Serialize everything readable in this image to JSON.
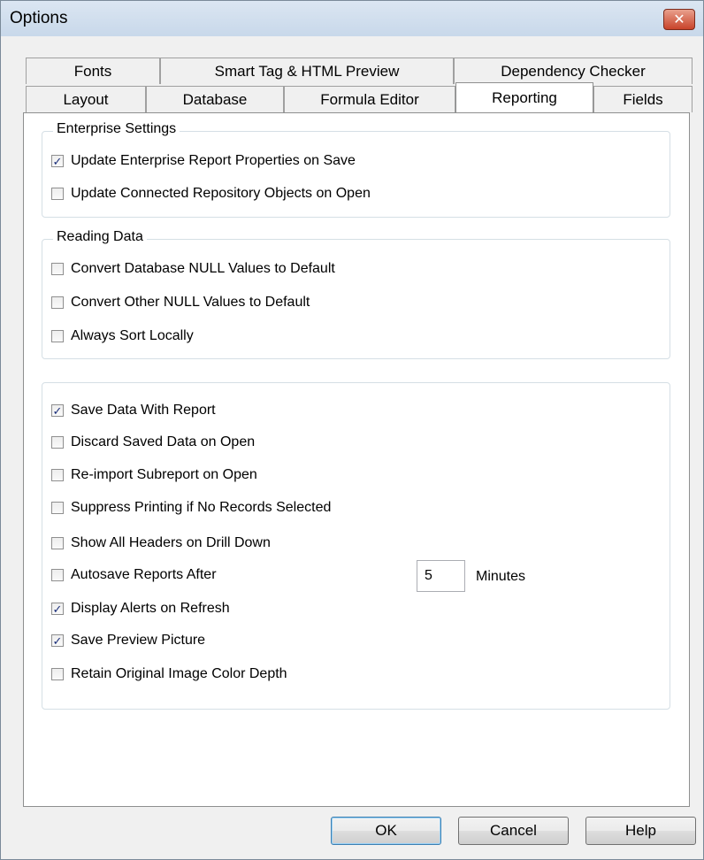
{
  "window": {
    "title": "Options",
    "close_symbol": "✕"
  },
  "tabs": {
    "row1": [
      "Fonts",
      "Smart Tag & HTML Preview",
      "Dependency Checker"
    ],
    "row2": [
      "Layout",
      "Database",
      "Formula Editor",
      "Reporting",
      "Fields"
    ],
    "active": "Reporting"
  },
  "enterprise": {
    "title": "Enterprise Settings",
    "items": [
      {
        "label": "Update Enterprise Report Properties on Save",
        "checked": true
      },
      {
        "label": "Update Connected Repository Objects on Open",
        "checked": false
      }
    ]
  },
  "reading": {
    "title": "Reading Data",
    "items": [
      {
        "label": "Convert Database NULL Values to Default",
        "checked": false
      },
      {
        "label": "Convert Other NULL Values to Default",
        "checked": false
      },
      {
        "label": "Always Sort Locally",
        "checked": false
      }
    ]
  },
  "options": {
    "items": [
      {
        "label": "Save Data With Report",
        "checked": true
      },
      {
        "label": "Discard Saved Data on Open",
        "checked": false
      },
      {
        "label": "Re-import Subreport on Open",
        "checked": false
      },
      {
        "label": "Suppress Printing if No Records Selected",
        "checked": false
      },
      {
        "label": "Show All Headers on Drill Down",
        "checked": false
      },
      {
        "label": "Autosave Reports After",
        "checked": false
      },
      {
        "label": "Display Alerts on Refresh",
        "checked": true
      },
      {
        "label": "Save Preview Picture",
        "checked": true
      },
      {
        "label": "Retain Original Image Color Depth",
        "checked": false
      }
    ],
    "autosave_minutes": "5",
    "minutes_label": "Minutes"
  },
  "buttons": {
    "ok": "OK",
    "cancel": "Cancel",
    "help": "Help"
  },
  "check_mark": "✓"
}
